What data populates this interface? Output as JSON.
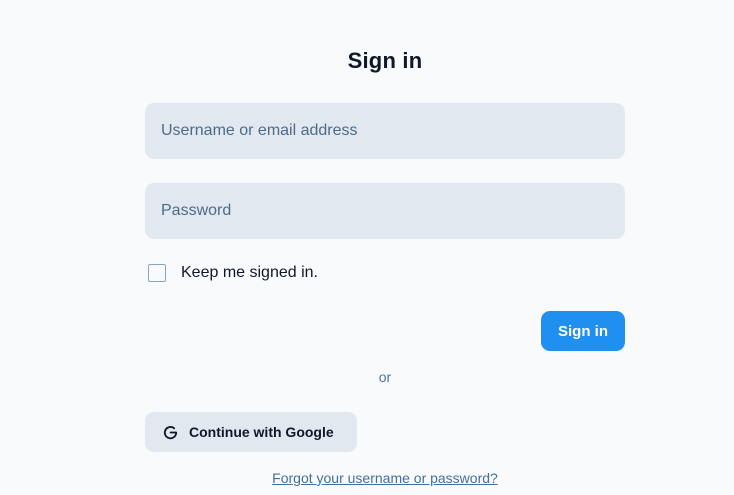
{
  "form": {
    "title": "Sign in",
    "username_placeholder": "Username or email address",
    "password_placeholder": "Password",
    "remember_label": "Keep me signed in.",
    "remember_checked": false,
    "signin_label": "Sign in",
    "divider_text": "or",
    "google_label": "Continue with Google",
    "forgot_link": "Forgot your username or password?"
  },
  "icons": {
    "google": "google-icon"
  },
  "colors": {
    "background": "#f8fafc",
    "field_background": "#e2e8f0",
    "primary_button": "#1f8ff0",
    "text": "#0f172a",
    "link": "#456f98"
  }
}
